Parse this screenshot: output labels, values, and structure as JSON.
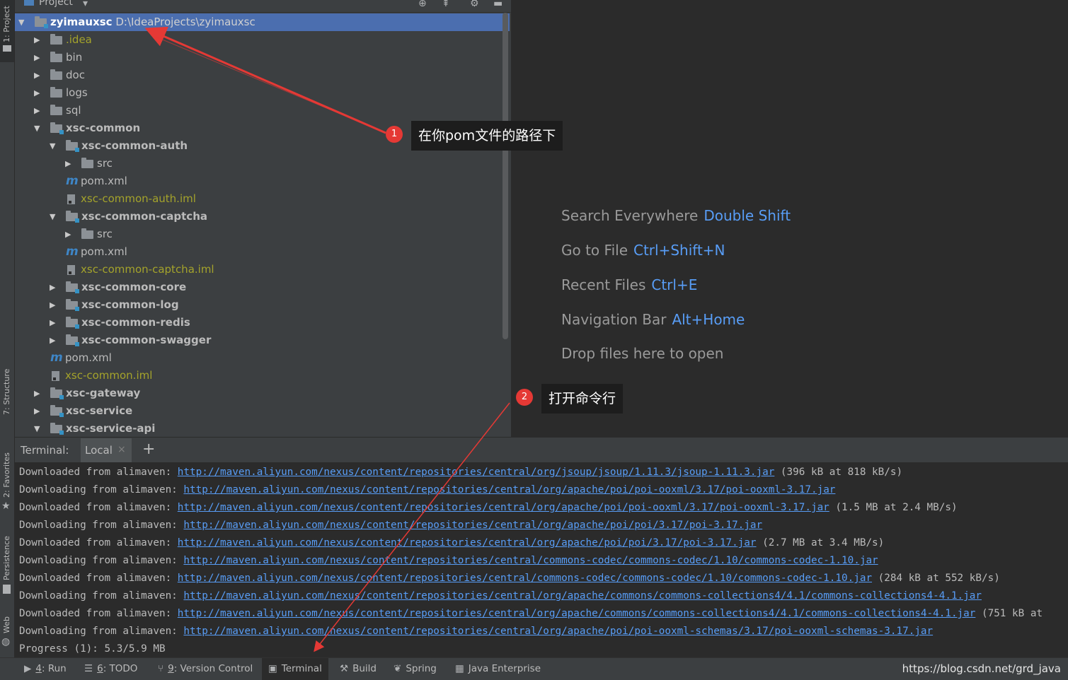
{
  "left_strip": {
    "tabs": [
      "1: Project",
      "7: Structure",
      "2: Favorites",
      "Persistence",
      "Web"
    ]
  },
  "project": {
    "title": "Project",
    "tree": [
      {
        "name": "zyimauxsc",
        "path": "D:\\IdeaProjects\\zyimauxsc",
        "kind": "module",
        "depth": 0,
        "expanded": true,
        "selected": true
      },
      {
        "name": ".idea",
        "kind": "folder",
        "depth": 1,
        "expanded": false,
        "color": "yellow"
      },
      {
        "name": "bin",
        "kind": "folder",
        "depth": 1,
        "expanded": false
      },
      {
        "name": "doc",
        "kind": "folder",
        "depth": 1,
        "expanded": false
      },
      {
        "name": "logs",
        "kind": "folder",
        "depth": 1,
        "expanded": false
      },
      {
        "name": "sql",
        "kind": "folder",
        "depth": 1,
        "expanded": false
      },
      {
        "name": "xsc-common",
        "kind": "module",
        "depth": 1,
        "expanded": true
      },
      {
        "name": "xsc-common-auth",
        "kind": "module",
        "depth": 2,
        "expanded": true
      },
      {
        "name": "src",
        "kind": "folder",
        "depth": 3,
        "expanded": false
      },
      {
        "name": "pom.xml",
        "kind": "maven",
        "depth": 3
      },
      {
        "name": "xsc-common-auth.iml",
        "kind": "iml",
        "depth": 3,
        "color": "yellow"
      },
      {
        "name": "xsc-common-captcha",
        "kind": "module",
        "depth": 2,
        "expanded": true
      },
      {
        "name": "src",
        "kind": "folder",
        "depth": 3,
        "expanded": false
      },
      {
        "name": "pom.xml",
        "kind": "maven",
        "depth": 3
      },
      {
        "name": "xsc-common-captcha.iml",
        "kind": "iml",
        "depth": 3,
        "color": "yellow"
      },
      {
        "name": "xsc-common-core",
        "kind": "module",
        "depth": 2,
        "expanded": false
      },
      {
        "name": "xsc-common-log",
        "kind": "module",
        "depth": 2,
        "expanded": false
      },
      {
        "name": "xsc-common-redis",
        "kind": "module",
        "depth": 2,
        "expanded": false
      },
      {
        "name": "xsc-common-swagger",
        "kind": "module",
        "depth": 2,
        "expanded": false
      },
      {
        "name": "pom.xml",
        "kind": "maven",
        "depth": 2
      },
      {
        "name": "xsc-common.iml",
        "kind": "iml",
        "depth": 2,
        "color": "yellow"
      },
      {
        "name": "xsc-gateway",
        "kind": "module",
        "depth": 1,
        "expanded": false
      },
      {
        "name": "xsc-service",
        "kind": "module",
        "depth": 1,
        "expanded": false
      },
      {
        "name": "xsc-service-api",
        "kind": "module",
        "depth": 1,
        "expanded": true
      }
    ]
  },
  "editor": {
    "hints": [
      {
        "text": "Search Everywhere",
        "key": "Double Shift"
      },
      {
        "text": "Go to File",
        "key": "Ctrl+Shift+N"
      },
      {
        "text": "Recent Files",
        "key": "Ctrl+E"
      },
      {
        "text": "Navigation Bar",
        "key": "Alt+Home"
      },
      {
        "text": "Drop files here to open",
        "key": ""
      }
    ]
  },
  "terminal": {
    "label": "Terminal:",
    "tab": "Local",
    "close": "×",
    "add": "+",
    "lines": [
      {
        "prefix": "Downloaded from alimaven: ",
        "url": "http://maven.aliyun.com/nexus/content/repositories/central/org/jsoup/jsoup/1.11.3/jsoup-1.11.3.jar",
        "suffix": " (396 kB at 818 kB/s)"
      },
      {
        "prefix": "Downloading from alimaven: ",
        "url": "http://maven.aliyun.com/nexus/content/repositories/central/org/apache/poi/poi-ooxml/3.17/poi-ooxml-3.17.jar",
        "suffix": ""
      },
      {
        "prefix": "Downloaded from alimaven: ",
        "url": "http://maven.aliyun.com/nexus/content/repositories/central/org/apache/poi/poi-ooxml/3.17/poi-ooxml-3.17.jar",
        "suffix": " (1.5 MB at 2.4 MB/s)"
      },
      {
        "prefix": "Downloading from alimaven: ",
        "url": "http://maven.aliyun.com/nexus/content/repositories/central/org/apache/poi/poi/3.17/poi-3.17.jar",
        "suffix": ""
      },
      {
        "prefix": "Downloaded from alimaven: ",
        "url": "http://maven.aliyun.com/nexus/content/repositories/central/org/apache/poi/poi/3.17/poi-3.17.jar",
        "suffix": " (2.7 MB at 3.4 MB/s)"
      },
      {
        "prefix": "Downloading from alimaven: ",
        "url": "http://maven.aliyun.com/nexus/content/repositories/central/commons-codec/commons-codec/1.10/commons-codec-1.10.jar",
        "suffix": ""
      },
      {
        "prefix": "Downloaded from alimaven: ",
        "url": "http://maven.aliyun.com/nexus/content/repositories/central/commons-codec/commons-codec/1.10/commons-codec-1.10.jar",
        "suffix": " (284 kB at 552 kB/s)"
      },
      {
        "prefix": "Downloading from alimaven: ",
        "url": "http://maven.aliyun.com/nexus/content/repositories/central/org/apache/commons/commons-collections4/4.1/commons-collections4-4.1.jar",
        "suffix": ""
      },
      {
        "prefix": "Downloaded from alimaven: ",
        "url": "http://maven.aliyun.com/nexus/content/repositories/central/org/apache/commons/commons-collections4/4.1/commons-collections4-4.1.jar",
        "suffix": " (751 kB at"
      },
      {
        "prefix": "Downloading from alimaven: ",
        "url": "http://maven.aliyun.com/nexus/content/repositories/central/org/apache/poi/poi-ooxml-schemas/3.17/poi-ooxml-schemas-3.17.jar",
        "suffix": ""
      },
      {
        "prefix": "Progress (1): 5.3/5.9 MB",
        "url": "",
        "suffix": ""
      }
    ]
  },
  "bottom_bar": {
    "tabs": [
      {
        "num": "4",
        "label": ": Run",
        "icon": "run-icon",
        "glyph": "▶"
      },
      {
        "num": "6",
        "label": ": TODO",
        "icon": "todo-icon",
        "glyph": "☰"
      },
      {
        "num": "9",
        "label": ": Version Control",
        "icon": "version-control-icon",
        "glyph": "⑂"
      },
      {
        "num": "",
        "label": "Terminal",
        "icon": "terminal-icon",
        "glyph": "▣",
        "active": true
      },
      {
        "num": "",
        "label": "Build",
        "icon": "hammer-icon",
        "glyph": "⚒"
      },
      {
        "num": "",
        "label": "Spring",
        "icon": "spring-leaf-icon",
        "glyph": "❦"
      },
      {
        "num": "",
        "label": "Java Enterprise",
        "icon": "java-enterprise-icon",
        "glyph": "▦"
      }
    ],
    "watermark": "https://blog.csdn.net/grd_java"
  },
  "annotations": [
    {
      "num": "1",
      "text": "在你pom文件的路径下"
    },
    {
      "num": "2",
      "text": "打开命令行"
    }
  ],
  "colors": {
    "selection": "#4b6eaf",
    "link": "#589df6",
    "annotation_arrow": "#e53935",
    "panel": "#3c3f41",
    "editor_bg": "#2b2b2b"
  }
}
